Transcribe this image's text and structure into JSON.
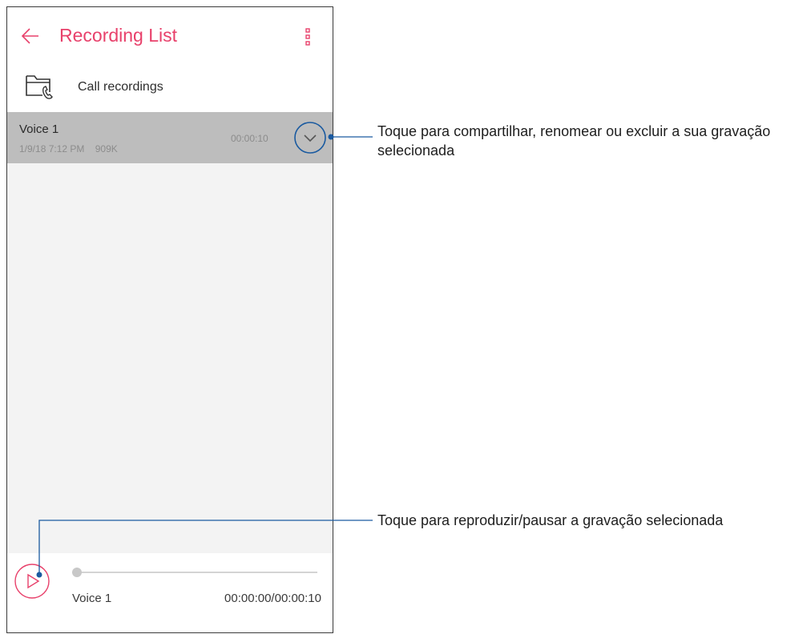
{
  "appbar": {
    "title": "Recording List",
    "back_icon": "arrow-left-icon",
    "more_icon": "more-vertical-icon",
    "accent_color": "#e8416b"
  },
  "folder": {
    "label": "Call recordings",
    "icon": "folder-phone-icon"
  },
  "recordings": [
    {
      "name": "Voice 1",
      "date": "1/9/18 7:12 PM",
      "size": "909K",
      "duration": "00:00:10",
      "selected": true
    }
  ],
  "player": {
    "name": "Voice 1",
    "time": "00:00:00/00:00:10",
    "progress": 0,
    "play_icon": "play-icon"
  },
  "callouts": {
    "expand": "Toque para compartilhar, renomear ou excluir a sua gravação selecionada",
    "play": "Toque para reproduzir/pausar a gravação selecionada",
    "line_color": "#1a5aa0"
  }
}
